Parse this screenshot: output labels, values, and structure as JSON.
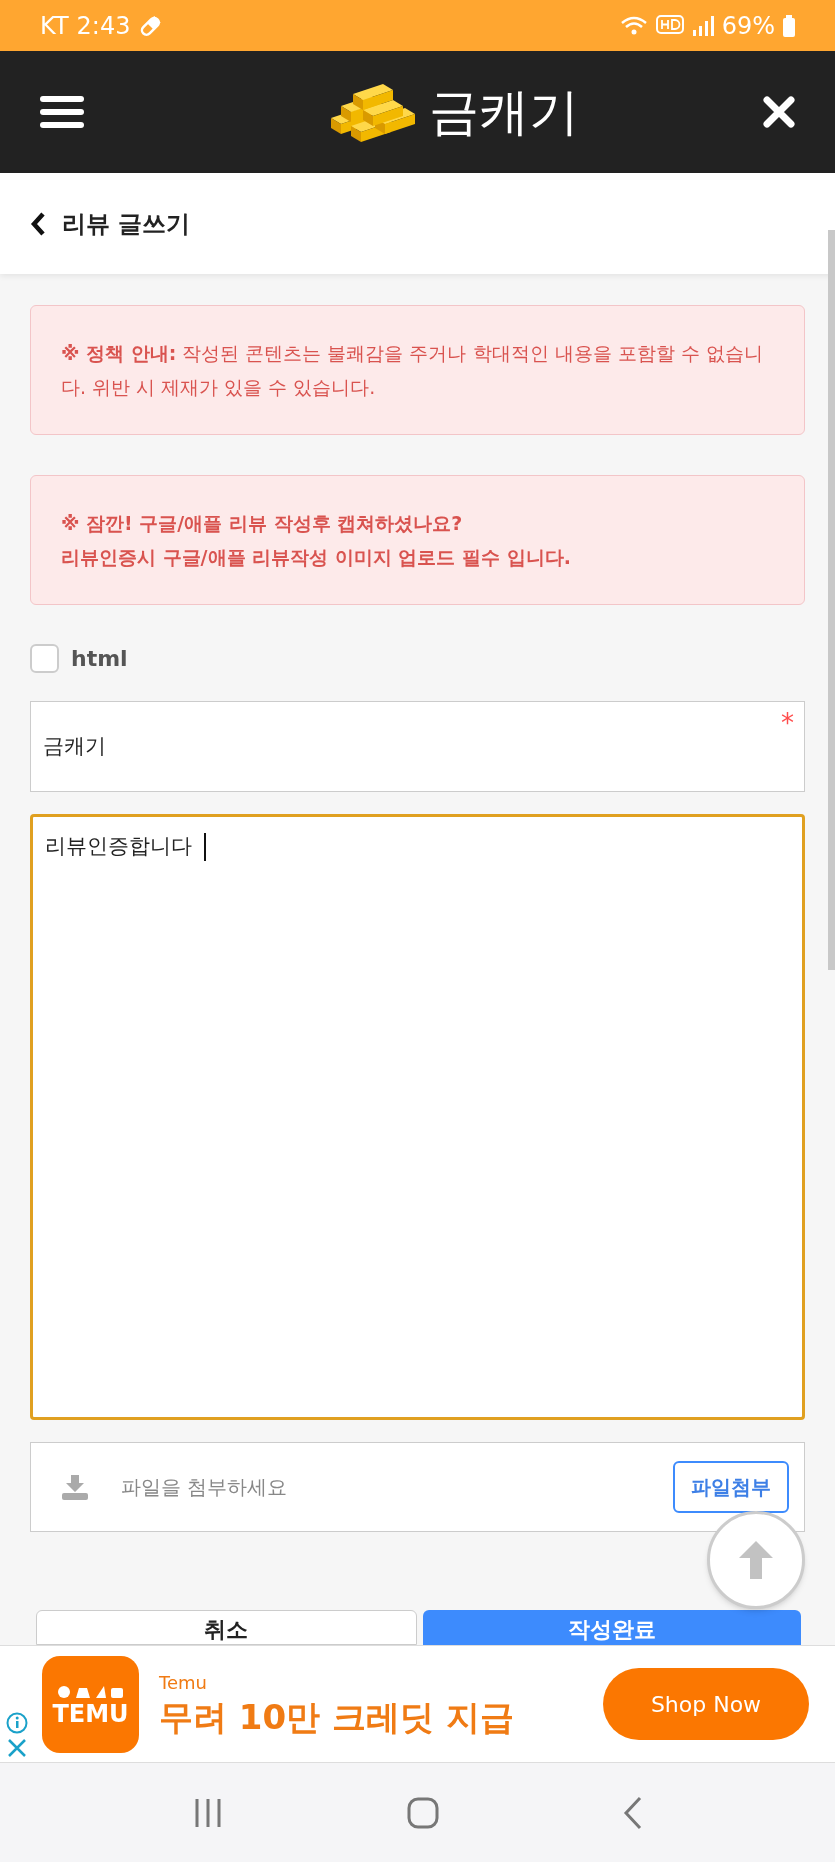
{
  "status_bar": {
    "carrier": "KT",
    "time": "2:43",
    "battery": "69%"
  },
  "header": {
    "title": "금캐기"
  },
  "page_title": "리뷰 글쓰기",
  "notices": [
    {
      "kind": "policy",
      "lines": [
        "**※ 정책 안내:** 작성된 콘텐츠는 불쾌감을 주거나 학대적인 내용을 포함할 수 없습니다. 위반 시 제재가 있을 수 있습니다."
      ]
    },
    {
      "kind": "alert",
      "lines": [
        "※ 잠깐! 구글/애플 리뷰 작성후 캡쳐하셨나요?",
        "리뷰인증시 구글/애플 리뷰작성 이미지 업로드 필수 입니다."
      ]
    }
  ],
  "html_checkbox": {
    "label": "html",
    "checked": false
  },
  "title_field": {
    "value": "금캐기",
    "required": true,
    "required_mark": "*"
  },
  "content_field": {
    "value": "리뷰인증합니다",
    "focused": true
  },
  "file_attach": {
    "placeholder": "파일을 첨부하세요",
    "button": "파일첨부"
  },
  "buttons": [
    {
      "label": "취소",
      "kind": "secondary"
    },
    {
      "label": "작성완료",
      "kind": "primary"
    }
  ],
  "ad": {
    "logo_text": "TEMU",
    "advertiser": "Temu",
    "headline": "무려 10만 크레딧 지급",
    "cta": "Shop Now"
  }
}
